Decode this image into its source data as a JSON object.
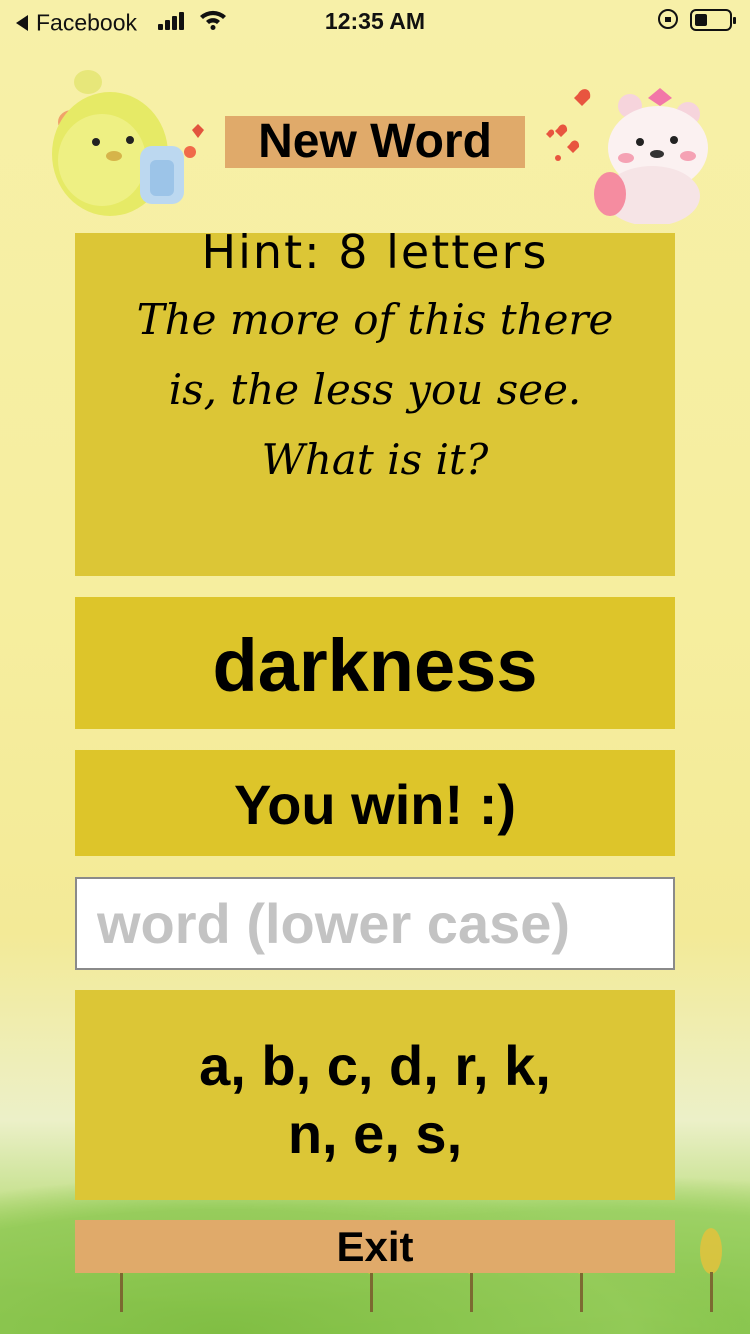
{
  "status_bar": {
    "back_app": "Facebook",
    "time": "12:35 AM",
    "battery_level": 0.35,
    "icons": [
      "back-arrow-icon",
      "signal-icon",
      "wifi-icon",
      "rotation-lock-icon",
      "battery-icon"
    ]
  },
  "header": {
    "new_word_label": "New Word"
  },
  "hint": {
    "title": "Hint: 8 letters",
    "text": "The more of this there is, the less you see. What is it?"
  },
  "game": {
    "word": "darkness",
    "result": "You win! :)"
  },
  "input": {
    "value": "",
    "placeholder": "word (lower case)"
  },
  "guessed_letters": {
    "line1": "a, b, c, d, r, k,",
    "line2": "n, e, s,"
  },
  "footer": {
    "exit_label": "Exit"
  },
  "colors": {
    "button_tan": "#e0aa6a",
    "card_gold": "#dcc636",
    "background": "#f7f0a8"
  }
}
